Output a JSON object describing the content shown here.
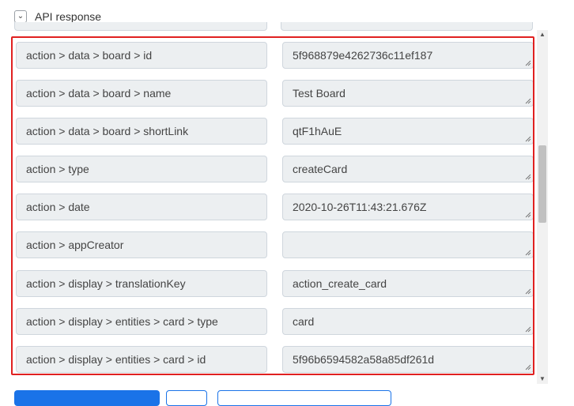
{
  "section": {
    "title": "API response",
    "toggle_glyph": "⌄"
  },
  "rows": [
    {
      "key": "action > data > board > id",
      "value": "5f968879e4262736c11ef187"
    },
    {
      "key": "action > data > board > name",
      "value": "Test Board"
    },
    {
      "key": "action > data > board > shortLink",
      "value": "qtF1hAuE"
    },
    {
      "key": "action > type",
      "value": "createCard"
    },
    {
      "key": "action > date",
      "value": "2020-10-26T11:43:21.676Z"
    },
    {
      "key": "action > appCreator",
      "value": ""
    },
    {
      "key": "action > display > translationKey",
      "value": "action_create_card"
    },
    {
      "key": "action > display > entities > card > type",
      "value": "card"
    },
    {
      "key": "action > display > entities > card > id",
      "value": "5f96b6594582a58a85df261d"
    }
  ],
  "scrollbar": {
    "up_glyph": "▲",
    "down_glyph": "▼"
  },
  "colors": {
    "selection_border": "#e02020",
    "field_background": "#eceff1",
    "primary": "#1a73e8"
  }
}
